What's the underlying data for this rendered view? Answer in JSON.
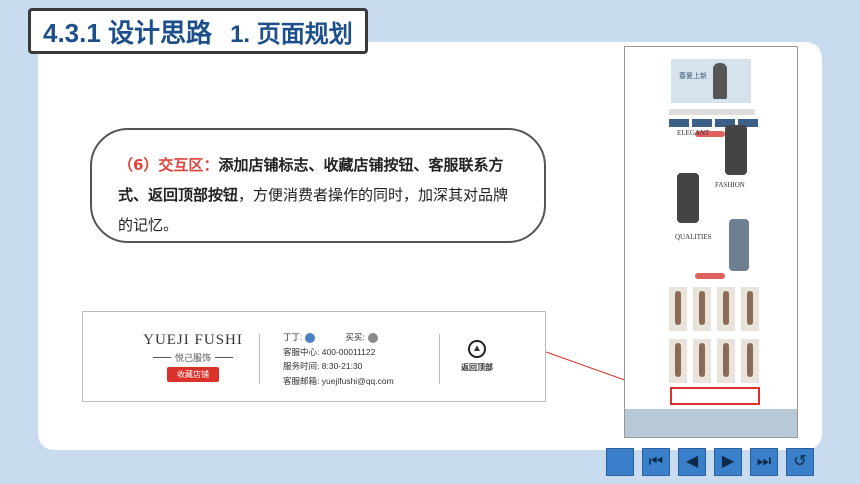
{
  "header": {
    "section": "4.3.1 设计思路",
    "subtitle": "1. 页面规划"
  },
  "callout": {
    "indent_label": "（6）交互区：",
    "bold_text": "添加店铺标志、收藏店铺按钮、客服联系方式、返回顶部按钮",
    "normal_text": "，方便消费者操作的同时，加深其对品牌的记忆。"
  },
  "footer_preview": {
    "brand_en": "YUEJI FUSHI",
    "brand_cn": "悦己服饰",
    "favorite_button": "收藏店铺",
    "contact_dingding": "丁丁:",
    "contact_wangwang": "买买:",
    "service_center_label": "客服中心:",
    "service_center_value": "400-00011122",
    "service_hours_label": "服务时间:",
    "service_hours_value": "8:30-21:30",
    "service_email_label": "客服邮箱:",
    "service_email_value": "yuejifushi@qq.com",
    "back_to_top": "返回顶部"
  },
  "page_preview": {
    "banner_text": "春夏上新",
    "word_1": "ELEGANT",
    "word_2": "FASHION",
    "word_3": "QUALITIES"
  },
  "nav": {
    "buttons": [
      "menu",
      "first",
      "prev",
      "next",
      "last",
      "return"
    ],
    "icons": {
      "first": "⏮",
      "prev": "◀",
      "next": "▶",
      "last": "⏭",
      "return": "↺"
    }
  },
  "colors": {
    "accent": "#3a7fc9",
    "highlight": "#d9322b",
    "title": "#1d4f8a"
  }
}
